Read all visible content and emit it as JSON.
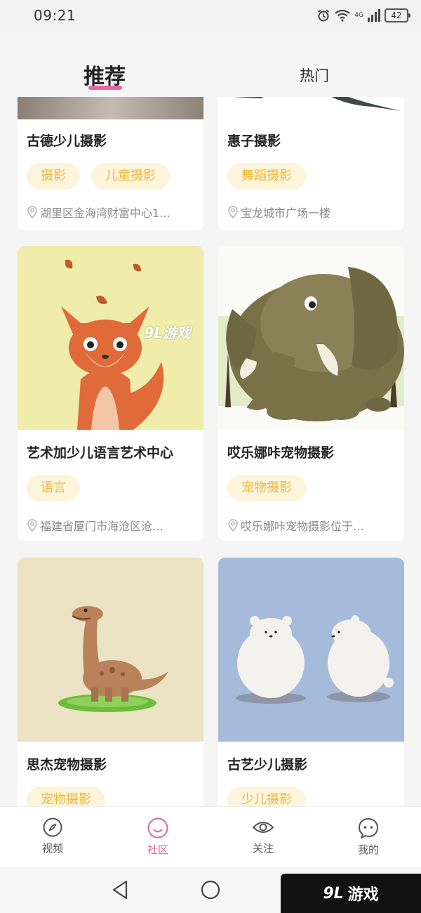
{
  "status_bar": {
    "time": "09:21",
    "network": "4G",
    "battery": "42"
  },
  "header": {
    "tab_recommend": "推荐",
    "tab_hot": "热门"
  },
  "cards": [
    {
      "title": "古德少儿摄影",
      "tags": [
        "摄影",
        "儿童摄影"
      ],
      "location": "湖里区金海湾财富中心1…"
    },
    {
      "title": "惠子摄影",
      "tags": [
        "舞蹈摄影"
      ],
      "location": "宝龙城市广场一楼"
    },
    {
      "title": "艺术加少儿语言艺术中心",
      "tags": [
        "语言"
      ],
      "location": "福建省厦门市海沧区沧…",
      "image_icon": "fox-illustration"
    },
    {
      "title": "哎乐娜咔宠物摄影",
      "tags": [
        "宠物摄影"
      ],
      "location": "哎乐娜咔宠物摄影位于…",
      "image_icon": "elephant-illustration"
    },
    {
      "title": "思杰宠物摄影",
      "tags": [
        "宠物摄影"
      ],
      "image_icon": "dinosaur-illustration"
    },
    {
      "title": "古艺少儿摄影",
      "tags": [
        "少儿摄影"
      ],
      "image_icon": "polar-bears-illustration"
    }
  ],
  "image_watermark": "9L游戏",
  "bottom_nav": {
    "items": [
      {
        "label": "视频",
        "icon": "compass-icon"
      },
      {
        "label": "社区",
        "icon": "smile-icon",
        "active": true
      },
      {
        "label": "关注",
        "icon": "eye-icon"
      },
      {
        "label": "我的",
        "icon": "chat-face-icon"
      }
    ]
  },
  "watermark": {
    "logo": "9L",
    "text": "游戏"
  },
  "colors": {
    "accent": "#e9649c",
    "tag_bg": "#fdf4dc",
    "tag_text": "#e8b93e"
  }
}
